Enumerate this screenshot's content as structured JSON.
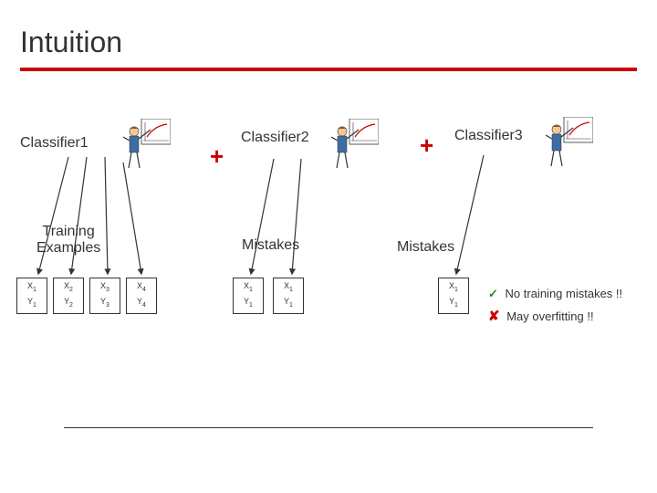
{
  "title": "Intuition",
  "classifier1_label": "Classifier1",
  "classifier2_label": "Classifier2",
  "classifier3_label": "Classifier3",
  "plus": "+",
  "training_label": "Training\nExamples",
  "mistakes_label": "Mistakes",
  "examples": {
    "group1": [
      {
        "x": "X",
        "xs": "1",
        "y": "Y",
        "ys": "1"
      },
      {
        "x": "X",
        "xs": "2",
        "y": "Y",
        "ys": "2"
      },
      {
        "x": "X",
        "xs": "3",
        "y": "Y",
        "ys": "3"
      },
      {
        "x": "X",
        "xs": "4",
        "y": "Y",
        "ys": "4"
      }
    ],
    "group2": [
      {
        "x": "X",
        "xs": "1",
        "y": "Y",
        "ys": "1"
      },
      {
        "x": "X",
        "xs": "1",
        "y": "Y",
        "ys": "1"
      }
    ],
    "group3": [
      {
        "x": "X",
        "xs": "1",
        "y": "Y",
        "ys": "1"
      }
    ]
  },
  "notes": {
    "check_symbol": "✓",
    "check_text": "No training mistakes !!",
    "cross_symbol": "✘",
    "cross_text": "May overfitting !!"
  }
}
